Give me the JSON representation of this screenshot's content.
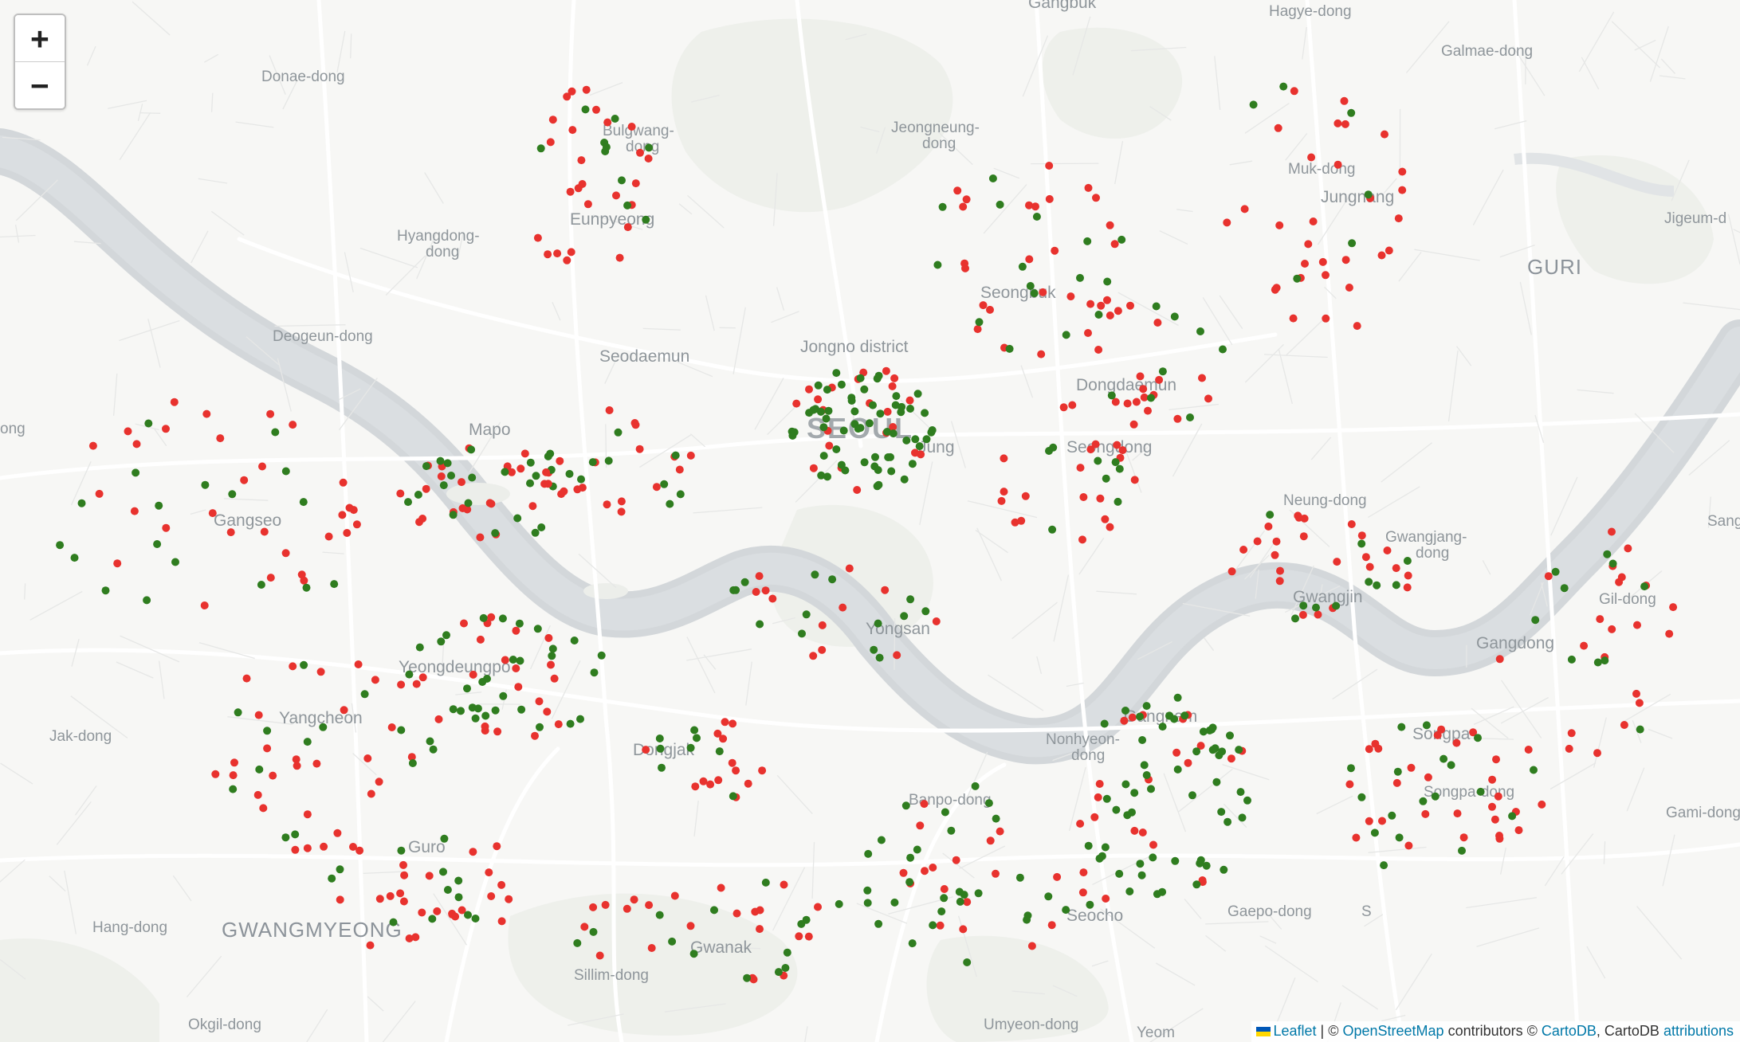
{
  "zoom": {
    "in_label": "+",
    "out_label": "−"
  },
  "attribution": {
    "leaflet": "Leaflet",
    "sep1": " | © ",
    "osm": "OpenStreetMap",
    "mid": " contributors © ",
    "cartodb": "CartoDB",
    "comma": ", CartoDB ",
    "attributions": "attributions"
  },
  "colors": {
    "red": "#e8322e",
    "green": "#2f7d1f",
    "river": "#d5d9dc",
    "bg": "#f7f7f5"
  },
  "places": [
    {
      "id": "gangbuk",
      "label": "Gangbuk"
    },
    {
      "id": "hagye",
      "label": "Hagye-dong"
    },
    {
      "id": "galmae",
      "label": "Galmae-dong"
    },
    {
      "id": "donae",
      "label": "Donae-dong"
    },
    {
      "id": "bulgwang1",
      "label": "Bulgwang-"
    },
    {
      "id": "bulgwang2",
      "label": "dong"
    },
    {
      "id": "jeongneung1",
      "label": "Jeongneung-"
    },
    {
      "id": "jeongneung2",
      "label": "dong"
    },
    {
      "id": "muk",
      "label": "Muk-dong"
    },
    {
      "id": "jungnang",
      "label": "Jungnang"
    },
    {
      "id": "jigeum",
      "label": "Jigeum-d"
    },
    {
      "id": "eunpyeong",
      "label": "Eunpyeong"
    },
    {
      "id": "hyangdong1",
      "label": "Hyangdong-"
    },
    {
      "id": "hyangdong2",
      "label": "dong"
    },
    {
      "id": "guri",
      "label": "GURI"
    },
    {
      "id": "seongbuk",
      "label": "Seongbuk"
    },
    {
      "id": "deogeun",
      "label": "Deogeun-dong"
    },
    {
      "id": "seodaemun",
      "label": "Seodaemun"
    },
    {
      "id": "jongno",
      "label": "Jongno district"
    },
    {
      "id": "dongdaemun",
      "label": "Dongdaemun"
    },
    {
      "id": "ong",
      "label": "ong"
    },
    {
      "id": "mapo",
      "label": "Mapo"
    },
    {
      "id": "seoul",
      "label": "SEOUL"
    },
    {
      "id": "jung",
      "label": "Jung"
    },
    {
      "id": "seongdong",
      "label": "Seongdong"
    },
    {
      "id": "neung",
      "label": "Neung-dong"
    },
    {
      "id": "gwangjang1",
      "label": "Gwangjang-"
    },
    {
      "id": "gwangjang2",
      "label": "dong"
    },
    {
      "id": "sangi",
      "label": "Sangi"
    },
    {
      "id": "gangseo",
      "label": "Gangseo"
    },
    {
      "id": "gwangjin",
      "label": "Gwangjin"
    },
    {
      "id": "gil",
      "label": "Gil-dong"
    },
    {
      "id": "yongsan",
      "label": "Yongsan"
    },
    {
      "id": "gangdong",
      "label": "Gangdong"
    },
    {
      "id": "yeongdeungpo",
      "label": "Yeongdeungpo"
    },
    {
      "id": "gangnam",
      "label": "Gangnam"
    },
    {
      "id": "yangcheon",
      "label": "Yangcheon"
    },
    {
      "id": "jak",
      "label": "Jak-dong"
    },
    {
      "id": "dongjak",
      "label": "Dongjak"
    },
    {
      "id": "nonhyeon1",
      "label": "Nonhyeon-"
    },
    {
      "id": "nonhyeon2",
      "label": "dong"
    },
    {
      "id": "songpa",
      "label": "Songpa"
    },
    {
      "id": "banpo",
      "label": "Banpo-dong"
    },
    {
      "id": "songpadong",
      "label": "Songpa-dong"
    },
    {
      "id": "gami",
      "label": "Gami-dong"
    },
    {
      "id": "guro",
      "label": "Guro"
    },
    {
      "id": "seocho",
      "label": "Seocho"
    },
    {
      "id": "gaepo",
      "label": "Gaepo-dong"
    },
    {
      "id": "s",
      "label": "S"
    },
    {
      "id": "hang",
      "label": "Hang-dong"
    },
    {
      "id": "gwangmyeong",
      "label": "GWANGMYEONG"
    },
    {
      "id": "gwanak",
      "label": "Gwanak"
    },
    {
      "id": "sillim",
      "label": "Sillim-dong"
    },
    {
      "id": "okgil",
      "label": "Okgil-dong"
    },
    {
      "id": "umyeon",
      "label": "Umyeon-dong"
    },
    {
      "id": "yeom",
      "label": "Yeom"
    }
  ],
  "markers_note": "Red and green circle markers scattered over Seoul districts",
  "marker_clusters": [
    {
      "district": "Eunpyeong",
      "red": 26,
      "green": 10
    },
    {
      "district": "Seodaemun",
      "red": 18,
      "green": 14
    },
    {
      "district": "Jongno/Jung",
      "red": 22,
      "green": 60
    },
    {
      "district": "Seongbuk",
      "red": 24,
      "green": 14
    },
    {
      "district": "Dongdaemun",
      "red": 22,
      "green": 10
    },
    {
      "district": "Jungnang",
      "red": 30,
      "green": 6
    },
    {
      "district": "Mapo",
      "red": 24,
      "green": 18
    },
    {
      "district": "Seongdong",
      "red": 18,
      "green": 8
    },
    {
      "district": "Gangseo",
      "red": 30,
      "green": 18
    },
    {
      "district": "Yangcheon",
      "red": 28,
      "green": 14
    },
    {
      "district": "Yeongdeungpo",
      "red": 22,
      "green": 30
    },
    {
      "district": "Guro",
      "red": 26,
      "green": 12
    },
    {
      "district": "Gwanak",
      "red": 22,
      "green": 14
    },
    {
      "district": "Dongjak",
      "red": 14,
      "green": 8
    },
    {
      "district": "Yongsan",
      "red": 12,
      "green": 14
    },
    {
      "district": "Gwangjin",
      "red": 24,
      "green": 10
    },
    {
      "district": "Gangnam",
      "red": 20,
      "green": 56
    },
    {
      "district": "Seocho",
      "red": 20,
      "green": 30
    },
    {
      "district": "Songpa",
      "red": 28,
      "green": 18
    },
    {
      "district": "Gangdong",
      "red": 22,
      "green": 10
    }
  ]
}
